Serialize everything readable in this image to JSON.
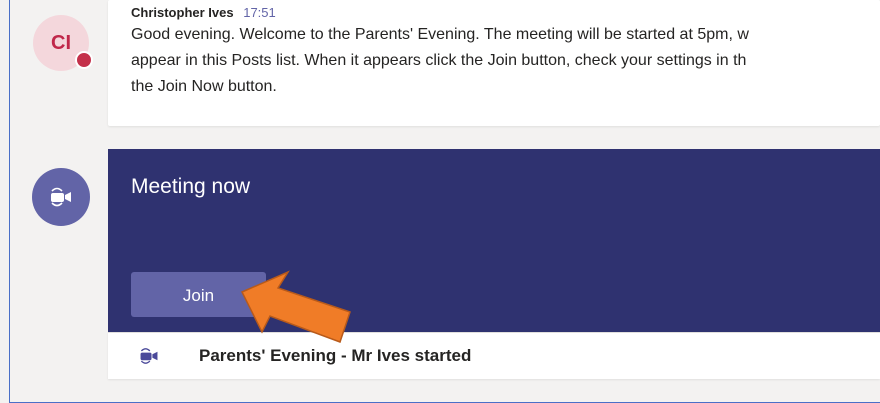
{
  "post": {
    "avatar_initials": "CI",
    "author": "Christopher Ives",
    "time": "17:51",
    "lines": [
      "Good evening. Welcome to the Parents' Evening. The meeting will be started at 5pm, w",
      "appear in this Posts list. When it appears click the Join button, check your settings in th",
      "the Join Now button."
    ],
    "presence_color": "#c4314b"
  },
  "meeting": {
    "title": "Meeting now",
    "join_label": "Join",
    "footer_text": "Parents' Evening - Mr Ives started",
    "icon": "video-camera-icon",
    "card_color": "#2f3270",
    "accent_color": "#6264a7"
  },
  "annotation": {
    "arrow_color": "#f07c27"
  }
}
